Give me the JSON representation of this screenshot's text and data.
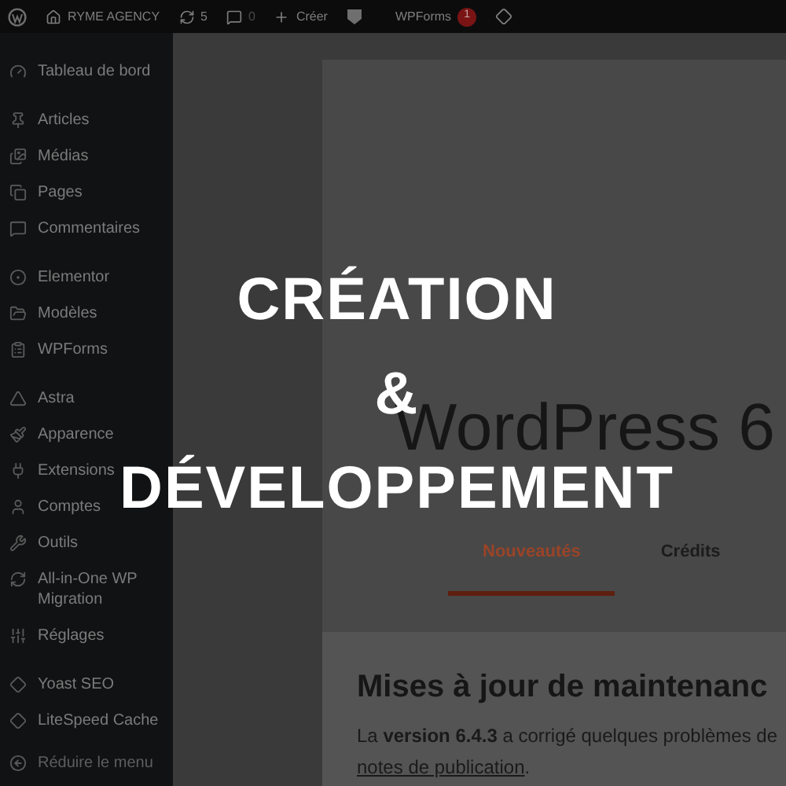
{
  "top_bar": {
    "site": "RYME AGENCY",
    "updates": "5",
    "comments": "0",
    "new": "Créer",
    "wpforms": "WPForms",
    "wpforms_badge": "1"
  },
  "sidebar": {
    "groups": [
      {
        "items": [
          "Tableau de bord"
        ]
      },
      {
        "items": [
          "Articles",
          "Médias",
          "Pages",
          "Commentaires"
        ]
      },
      {
        "items": [
          "Elementor",
          "Modèles",
          "WPForms"
        ]
      },
      {
        "items": [
          "Astra",
          "Apparence",
          "Extensions",
          "Comptes",
          "Outils",
          "All-in-One WP Migration",
          "Réglages"
        ]
      },
      {
        "items": [
          "Yoast SEO",
          "LiteSpeed Cache"
        ]
      }
    ],
    "collapse": "Réduire le menu"
  },
  "content": {
    "heading": "WordPress 6",
    "tabs": [
      {
        "label": "Nouveautés",
        "selected": true
      },
      {
        "label": "Crédits",
        "selected": false
      }
    ],
    "section_title": "Mises à jour de maintenanc",
    "paragraph": "La **version 6.4.3** a corrigé quelques problèmes de",
    "link": "notes de publication",
    "link_tail": "."
  },
  "overlay": {
    "lines": [
      "CRÉATION",
      "&",
      "DÉVELOPPEMENT"
    ]
  }
}
